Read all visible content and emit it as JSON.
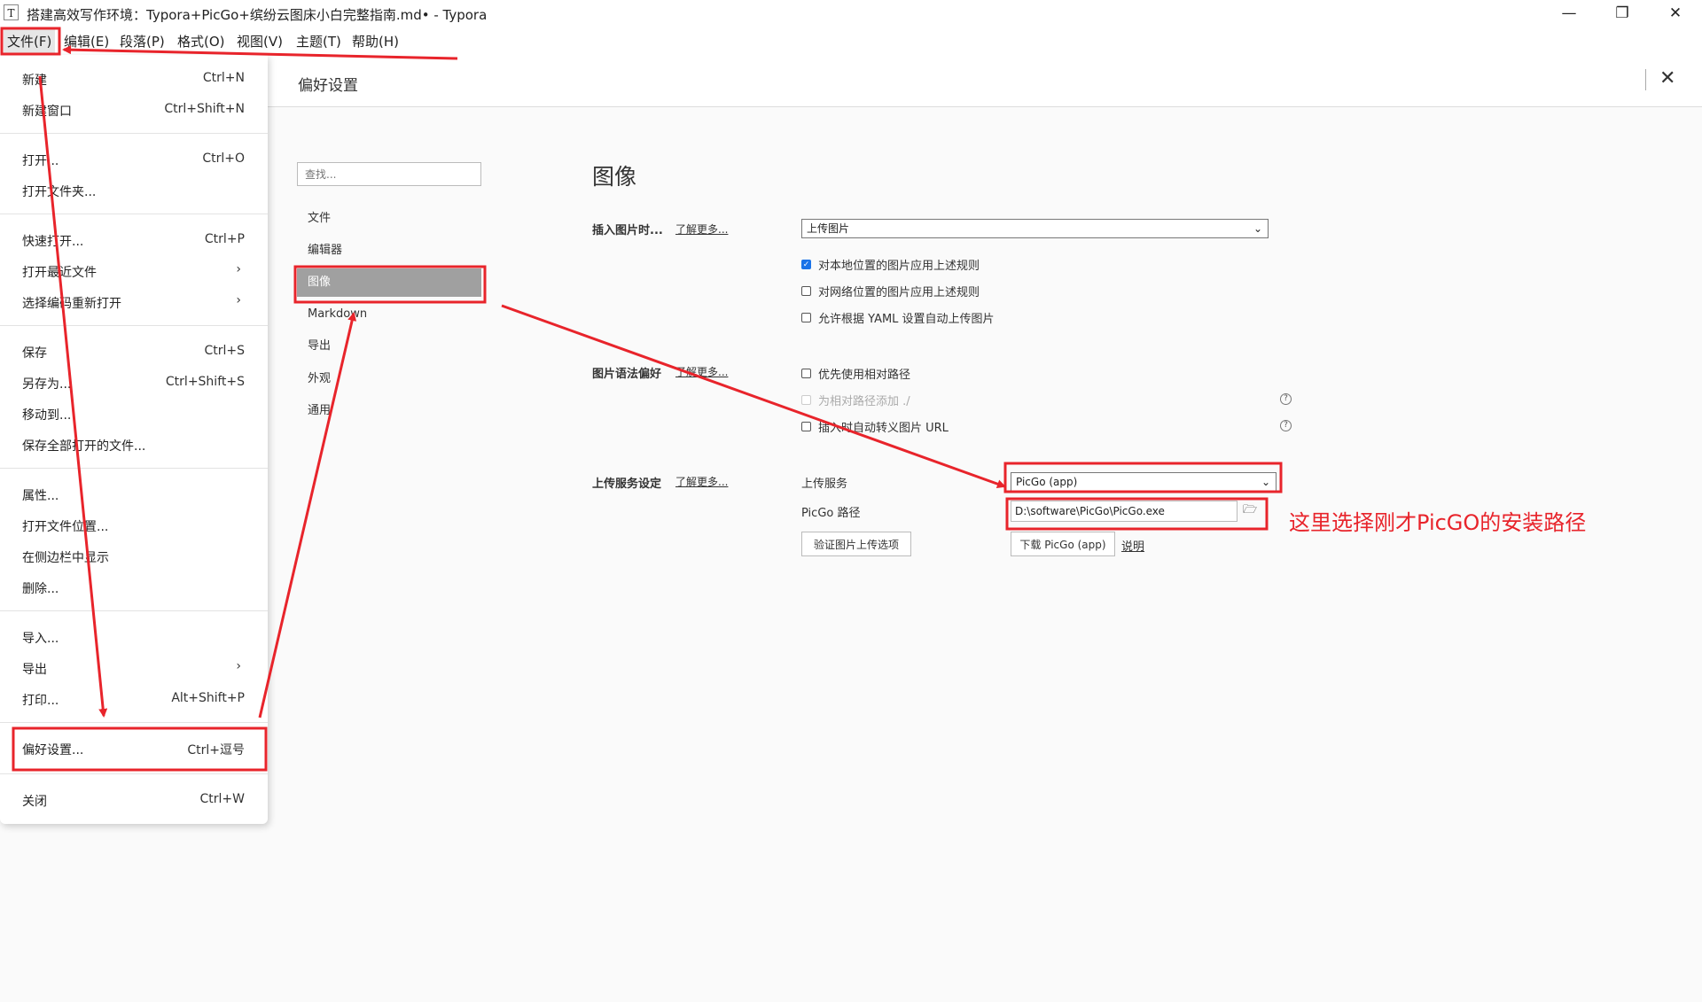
{
  "window": {
    "icon_letter": "T",
    "title": "搭建高效写作环境：Typora+PicGo+缤纷云图床小白完整指南.md• - Typora",
    "controls": [
      "—",
      "❐",
      "✕"
    ]
  },
  "menubar": [
    "文件(F)",
    "编辑(E)",
    "段落(P)",
    "格式(O)",
    "视图(V)",
    "主题(T)",
    "帮助(H)"
  ],
  "file_menu": {
    "items": [
      {
        "label": "新建",
        "shortcut": "Ctrl+N"
      },
      {
        "label": "新建窗口",
        "shortcut": "Ctrl+Shift+N"
      },
      {
        "label": "打开...",
        "shortcut": "Ctrl+O"
      },
      {
        "label": "打开文件夹...",
        "shortcut": ""
      },
      {
        "label": "快速打开...",
        "shortcut": "Ctrl+P"
      },
      {
        "label": "打开最近文件",
        "shortcut": "",
        "submenu": "›"
      },
      {
        "label": "选择编码重新打开",
        "shortcut": "",
        "submenu": "›"
      },
      {
        "label": "保存",
        "shortcut": "Ctrl+S"
      },
      {
        "label": "另存为...",
        "shortcut": "Ctrl+Shift+S"
      },
      {
        "label": "移动到...",
        "shortcut": ""
      },
      {
        "label": "保存全部打开的文件...",
        "shortcut": ""
      },
      {
        "label": "属性...",
        "shortcut": ""
      },
      {
        "label": "打开文件位置...",
        "shortcut": ""
      },
      {
        "label": "在侧边栏中显示",
        "shortcut": ""
      },
      {
        "label": "删除...",
        "shortcut": ""
      },
      {
        "label": "导入...",
        "shortcut": ""
      },
      {
        "label": "导出",
        "shortcut": "",
        "submenu": "›"
      },
      {
        "label": "打印...",
        "shortcut": "Alt+Shift+P"
      },
      {
        "label": "偏好设置...",
        "shortcut": "Ctrl+逗号"
      },
      {
        "label": "关闭",
        "shortcut": "Ctrl+W"
      }
    ]
  },
  "preferences": {
    "title": "偏好设置",
    "close": "✕",
    "search_placeholder": "查找...",
    "nav": [
      "文件",
      "编辑器",
      "图像",
      "Markdown",
      "导出",
      "外观",
      "通用"
    ],
    "active_nav": "图像",
    "section_title": "图像",
    "insert_image": {
      "label": "插入图片时...",
      "learn_more": "了解更多...",
      "select_value": "上传图片",
      "options": [
        {
          "label": "对本地位置的图片应用上述规则",
          "checked": true
        },
        {
          "label": "对网络位置的图片应用上述规则",
          "checked": false
        },
        {
          "label": "允许根据 YAML 设置自动上传图片",
          "checked": false
        }
      ]
    },
    "image_syntax": {
      "label": "图片语法偏好",
      "learn_more": "了解更多...",
      "options": [
        {
          "label": "优先使用相对路径",
          "checked": false,
          "disabled": false
        },
        {
          "label": "为相对路径添加 ./",
          "checked": false,
          "disabled": true
        },
        {
          "label": "插入时自动转义图片 URL",
          "checked": false,
          "disabled": false
        }
      ],
      "help_icon": "?"
    },
    "upload_service": {
      "label": "上传服务设定",
      "learn_more": "了解更多...",
      "service_label": "上传服务",
      "service_value": "PicGo (app)",
      "path_label": "PicGo 路径",
      "path_value": "D:\\software\\PicGo\\PicGo.exe",
      "folder_icon": "folder-icon",
      "verify_button": "验证图片上传选项",
      "download_button": "下载 PicGo (app)",
      "doc_link": "说明"
    }
  },
  "annotation": {
    "text": "这里选择刚才PicGO的安装路径",
    "color": "#e8242b"
  }
}
